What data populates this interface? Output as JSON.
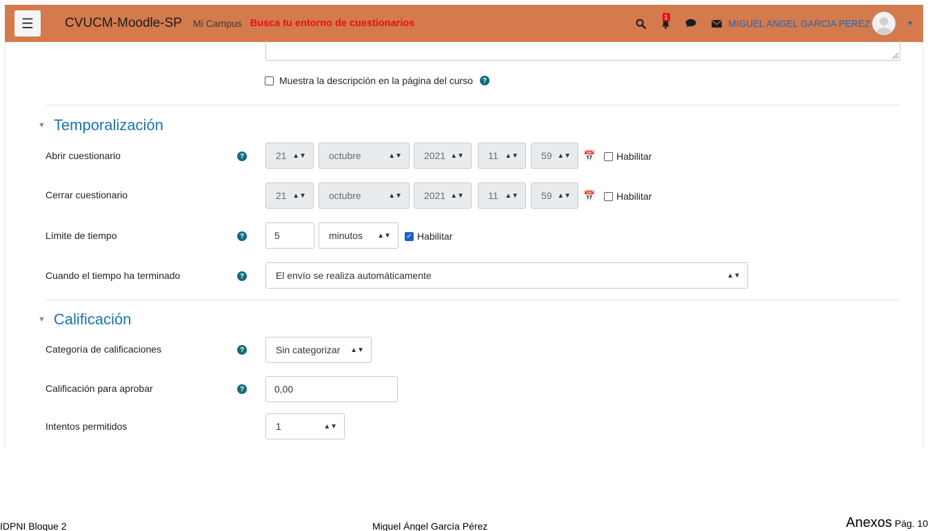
{
  "navbar": {
    "menu_icon": "hamburger-icon",
    "brand": "CVUCM-Moodle-SP",
    "link_campus": "Mi Campus",
    "link_search": "Busca tu entorno de cuestionarios",
    "notification_count": "1",
    "user_name": "MIGUEL ANGEL GARCIA PEREZ",
    "colors": {
      "bar": "#d47a4c",
      "search_link": "#e8101a",
      "user": "#1565c0"
    }
  },
  "description": {
    "show_on_course_label": "Muestra la descripción en la página del curso",
    "show_on_course_checked": false
  },
  "timing": {
    "title": "Temporalización",
    "open": {
      "label": "Abrir cuestionario",
      "day": "21",
      "month": "octubre",
      "year": "2021",
      "hour": "11",
      "minute": "59",
      "enable_label": "Habilitar",
      "enabled": false
    },
    "close": {
      "label": "Cerrar cuestionario",
      "day": "21",
      "month": "octubre",
      "year": "2021",
      "hour": "11",
      "minute": "59",
      "enable_label": "Habilitar",
      "enabled": false
    },
    "time_limit": {
      "label": "Límite de tiempo",
      "value": "5",
      "unit": "minutos",
      "enable_label": "Habilitar",
      "enabled": true
    },
    "when_time_expires": {
      "label": "Cuando el tiempo ha terminado",
      "value": "El envío se realiza automáticamente"
    }
  },
  "grade": {
    "title": "Calificación",
    "category": {
      "label": "Categoría de calificaciones",
      "value": "Sin categorizar"
    },
    "pass_grade": {
      "label": "Calificación para aprobar",
      "value": "0,00"
    },
    "attempts": {
      "label": "Intentos permitidos",
      "value": "1"
    }
  },
  "footer": {
    "left": "IDPNI Bloque 2",
    "center": "Miguel Ángel García Pérez",
    "right_title": "Anexos",
    "right_page": "Pág. 10"
  }
}
